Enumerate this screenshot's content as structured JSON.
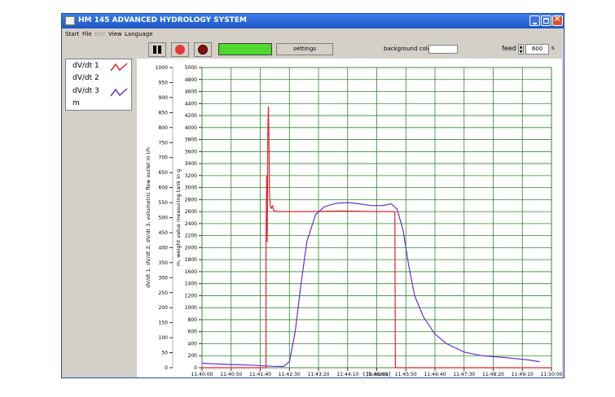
{
  "window": {
    "title": "HM 145 ADVANCED HYDROLOGY SYSTEM"
  },
  "menu": [
    {
      "label": "Start",
      "enabled": true
    },
    {
      "label": "File",
      "enabled": true
    },
    {
      "label": "Edit",
      "enabled": false
    },
    {
      "label": "View",
      "enabled": true
    },
    {
      "label": "Language",
      "enabled": true
    }
  ],
  "toolbar": {
    "settings_label": "settings",
    "background_color_label": "background color",
    "feed_label": "feed",
    "feed_value": "600",
    "feed_unit": "s",
    "progress_color": "#4fd82d",
    "led1_color": "#e23a3a",
    "led2_color": "#8a0f0f"
  },
  "legend": [
    {
      "label": "dV/dt 1",
      "color": "#e8202a",
      "icon": "zigzag"
    },
    {
      "label": "dV/dt 2",
      "color": "",
      "icon": "none"
    },
    {
      "label": "dV/dt 3",
      "color": "#6a2ed0",
      "icon": "zigzag"
    },
    {
      "label": "m",
      "color": "",
      "icon": "none"
    }
  ],
  "chart_data": {
    "type": "line",
    "xlabel": "t [h:min:s]",
    "ylabel_left": "dV/dt 1, dV/dt 2, dV/dt 3, volumetric flow outlet in l/h",
    "ylabel_right": "m, weight value measuring tank in g",
    "xlim": [
      "11:40:00",
      "11:50:00"
    ],
    "x_ticks": [
      "11:40:00",
      "11:40:50",
      "11:41:40",
      "11:42:30",
      "11:43:20",
      "11:44:10",
      "11:45:00",
      "11:45:50",
      "11:46:40",
      "11:47:30",
      "11:48:20",
      "11:49:10",
      "11:50:00"
    ],
    "ylim_left": [
      0,
      1000
    ],
    "y_ticks_left": [
      "0",
      "50",
      "100",
      "150",
      "200",
      "250",
      "300",
      "350",
      "400",
      "450",
      "500",
      "550",
      "600",
      "650",
      "700",
      "750",
      "800",
      "850",
      "900",
      "950",
      "1000"
    ],
    "ylim_right": [
      0,
      5000
    ],
    "y_ticks_right": [
      "0",
      "200",
      "400",
      "600",
      "800",
      "1000",
      "1200",
      "1400",
      "1600",
      "1800",
      "2000",
      "2200",
      "2400",
      "2600",
      "2800",
      "3000",
      "3200",
      "3400",
      "3600",
      "3800",
      "4000",
      "4200",
      "4400",
      "4600",
      "4800",
      "5000"
    ],
    "grid": true,
    "grid_color": "#2b8a2b",
    "series": [
      {
        "name": "dV/dt 1",
        "color": "#e8202a",
        "axis": "right",
        "points": [
          [
            "11:40:00",
            0
          ],
          [
            "11:41:50",
            0
          ],
          [
            "11:41:50",
            2150
          ],
          [
            "11:41:51",
            3200
          ],
          [
            "11:41:52",
            2100
          ],
          [
            "11:41:53",
            3900
          ],
          [
            "11:41:54",
            4350
          ],
          [
            "11:41:55",
            3800
          ],
          [
            "11:41:56",
            2900
          ],
          [
            "11:41:57",
            2700
          ],
          [
            "11:41:59",
            2650
          ],
          [
            "11:42:01",
            2700
          ],
          [
            "11:42:03",
            2620
          ],
          [
            "11:42:10",
            2600
          ],
          [
            "11:43:00",
            2600
          ],
          [
            "11:44:00",
            2610
          ],
          [
            "11:45:00",
            2600
          ],
          [
            "11:45:31",
            2600
          ],
          [
            "11:45:32",
            0
          ],
          [
            "11:50:00",
            0
          ]
        ]
      },
      {
        "name": "dV/dt 3",
        "color": "#6a2ed0",
        "axis": "right",
        "points": [
          [
            "11:40:00",
            75
          ],
          [
            "11:40:40",
            55
          ],
          [
            "11:41:20",
            45
          ],
          [
            "11:42:00",
            25
          ],
          [
            "11:42:20",
            20
          ],
          [
            "11:42:30",
            100
          ],
          [
            "11:42:40",
            600
          ],
          [
            "11:42:50",
            1400
          ],
          [
            "11:43:00",
            2100
          ],
          [
            "11:43:15",
            2550
          ],
          [
            "11:43:30",
            2680
          ],
          [
            "11:43:50",
            2740
          ],
          [
            "11:44:10",
            2750
          ],
          [
            "11:44:30",
            2730
          ],
          [
            "11:44:50",
            2700
          ],
          [
            "11:45:10",
            2700
          ],
          [
            "11:45:25",
            2730
          ],
          [
            "11:45:35",
            2640
          ],
          [
            "11:45:45",
            2300
          ],
          [
            "11:45:55",
            1700
          ],
          [
            "11:46:05",
            1200
          ],
          [
            "11:46:20",
            850
          ],
          [
            "11:46:40",
            560
          ],
          [
            "11:47:00",
            400
          ],
          [
            "11:47:30",
            260
          ],
          [
            "11:48:00",
            200
          ],
          [
            "11:48:40",
            170
          ],
          [
            "11:49:20",
            130
          ],
          [
            "11:49:40",
            100
          ]
        ]
      }
    ]
  }
}
